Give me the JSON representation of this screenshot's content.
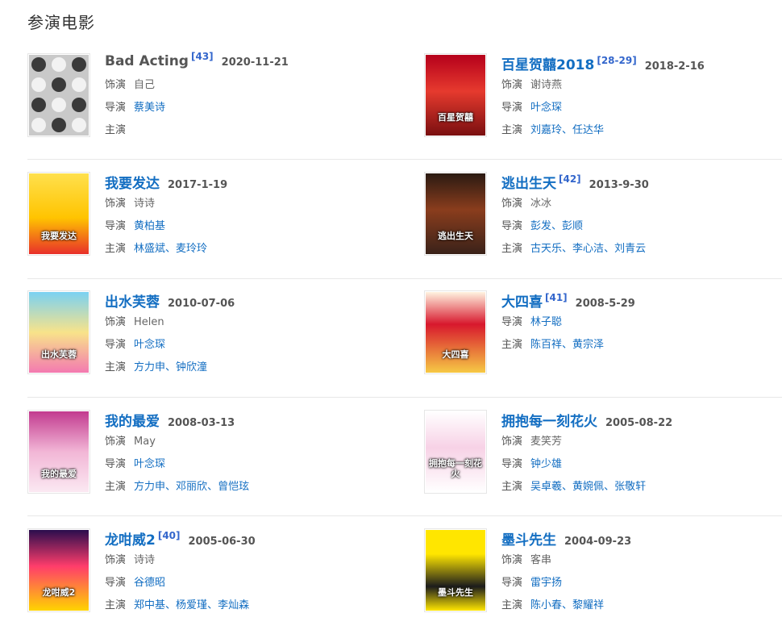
{
  "section": {
    "title": "参演电影"
  },
  "labels": {
    "role": "饰演",
    "director": "导演",
    "cast": "主演"
  },
  "films": [
    {
      "title": "Bad Acting",
      "ref": "[43]",
      "date": "2020-11-21",
      "role": "自己",
      "director": [
        "蔡美诗"
      ],
      "cast": []
    },
    {
      "title": "百星贺囍2018",
      "ref": "[28-29]",
      "date": "2018-2-16",
      "role": "谢诗燕",
      "director": [
        "叶念琛"
      ],
      "cast": [
        "刘嘉玲",
        "任达华"
      ]
    },
    {
      "title": "我要发达",
      "ref": "",
      "date": "2017-1-19",
      "role": "诗诗",
      "director": [
        "黄柏基"
      ],
      "cast": [
        "林盛斌",
        "麦玲玲"
      ]
    },
    {
      "title": "逃出生天",
      "ref": "[42]",
      "date": "2013-9-30",
      "role": "冰冰",
      "director": [
        "彭发",
        "彭顺"
      ],
      "cast": [
        "古天乐",
        "李心洁",
        "刘青云"
      ]
    },
    {
      "title": "出水芙蓉",
      "ref": "",
      "date": "2010-07-06",
      "role": "Helen",
      "director": [
        "叶念琛"
      ],
      "cast": [
        "方力申",
        "钟欣潼"
      ]
    },
    {
      "title": "大四喜",
      "ref": "[41]",
      "date": "2008-5-29",
      "role": "",
      "director": [
        "林子聪"
      ],
      "cast": [
        "陈百祥",
        "黄宗泽"
      ]
    },
    {
      "title": "我的最爱",
      "ref": "",
      "date": "2008-03-13",
      "role": "May",
      "director": [
        "叶念琛"
      ],
      "cast": [
        "方力申",
        "邓丽欣",
        "曾恺玹"
      ]
    },
    {
      "title": "拥抱每一刻花火",
      "ref": "",
      "date": "2005-08-22",
      "role": "麦笑芳",
      "director": [
        "钟少雄"
      ],
      "cast": [
        "吴卓羲",
        "黄婉佩",
        "张敬轩"
      ]
    },
    {
      "title": "龙咁威2",
      "ref": "[40]",
      "date": "2005-06-30",
      "role": "诗诗",
      "director": [
        "谷德昭"
      ],
      "cast": [
        "郑中基",
        "杨爱瑾",
        "李灿森"
      ]
    },
    {
      "title": "墨斗先生",
      "ref": "",
      "date": "2004-09-23",
      "role": "客串",
      "director": [
        "雷宇扬"
      ],
      "cast": [
        "陈小春",
        "黎耀祥"
      ]
    }
  ],
  "posters": [
    {
      "caption": "",
      "icon": "face-grid-icon"
    },
    {
      "caption": "百星贺囍",
      "icon": "poster-icon"
    },
    {
      "caption": "我要发达",
      "icon": "poster-icon"
    },
    {
      "caption": "逃出生天",
      "icon": "poster-icon"
    },
    {
      "caption": "出水芙蓉",
      "icon": "poster-icon"
    },
    {
      "caption": "大四喜",
      "icon": "poster-icon"
    },
    {
      "caption": "我的最爱",
      "icon": "poster-icon"
    },
    {
      "caption": "拥抱每一刻花火",
      "icon": "poster-icon"
    },
    {
      "caption": "龙咁威2",
      "icon": "poster-icon"
    },
    {
      "caption": "墨斗先生",
      "icon": "poster-icon"
    }
  ],
  "colors": {
    "link": "#136ec2",
    "ref": "#3366cc",
    "text": "#555555",
    "divider": "#e8e8e8"
  }
}
